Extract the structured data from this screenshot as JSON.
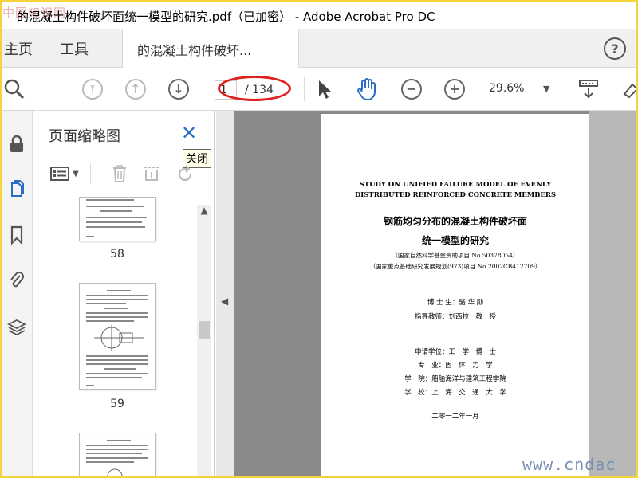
{
  "window": {
    "watermark": "中国知识网",
    "title": "的混凝土构件破坏面统一模型的研究.pdf（已加密） - Adobe Acrobat Pro DC"
  },
  "tabs": {
    "home": "主页",
    "tools": "工具",
    "document": "的混凝土构件破坏..."
  },
  "help": "?",
  "toolbar": {
    "page_current": "1",
    "page_total": "/ 134",
    "zoom": "29.6%"
  },
  "panel": {
    "title": "页面缩略图",
    "close_tooltip": "关闭",
    "thumbnails": [
      {
        "label": "58"
      },
      {
        "label": "59"
      },
      {
        "label": ""
      }
    ]
  },
  "document": {
    "en_title_1": "STUDY ON UNIFIED FAILURE MODEL OF EVENLY",
    "en_title_2": "DISTRIBUTED REINFORCED CONCRETE MEMBERS",
    "cn_title_1": "钢筋均匀分布的混凝土构件破坏面",
    "cn_title_2": "统一模型的研究",
    "fund_1": "（国家自然科学基金资助项目 No.50378054）",
    "fund_2": "（国家重点基础研究发展规划(973)项目 No.2002CB412709）",
    "student": "博 士 生：骆 华 勋",
    "advisor": "指导教师：刘西拉　教　授",
    "degree": "申请学位：工　学　博　士",
    "major": "专　业：固　体　力　学",
    "school": "学　院：船舶海洋与建筑工程学院",
    "university": "学　校：上　海　交　通　大　学",
    "date": "二零一二年一月",
    "watermark": "www.cndac"
  }
}
